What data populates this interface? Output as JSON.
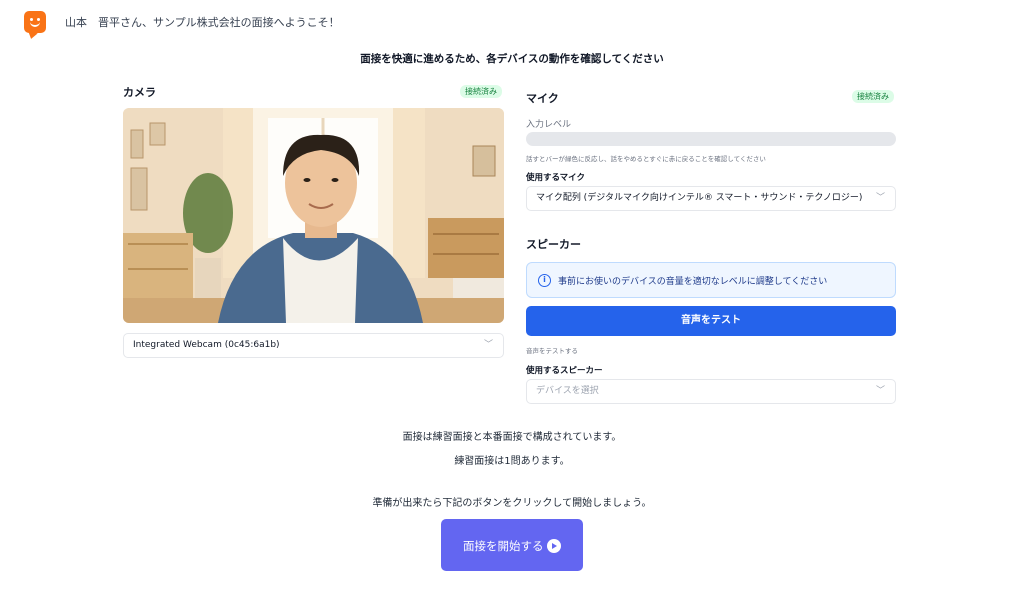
{
  "header": {
    "logo_icon": "smile-chat-icon",
    "welcome": "山本　晋平さん、サンプル株式会社の面接へようこそ！"
  },
  "subtitle": "面接を快適に進めるため、各デバイスの動作を確認してください",
  "camera": {
    "title": "カメラ",
    "status": "接続済み",
    "selected_device": "Integrated Webcam (0c45:6a1b)"
  },
  "mic": {
    "title": "マイク",
    "status": "接続済み",
    "level_label": "入力レベル",
    "level": 0,
    "hint": "話すとバーが緑色に反応し、話をやめるとすぐに赤に戻ることを確認してください",
    "select_label": "使用するマイク",
    "selected_device": "マイク配列 (デジタルマイク向けインテル® スマート・サウンド・テクノロジー)"
  },
  "speaker": {
    "title": "スピーカー",
    "info": "事前にお使いのデバイスの音量を適切なレベルに調整してください",
    "test_button": "音声をテスト",
    "test_hint": "音声をテストする",
    "select_label": "使用するスピーカー",
    "select_placeholder": "デバイスを選択"
  },
  "notes": {
    "line1": "面接は練習面接と本番面接で構成されています。",
    "line2": "練習面接は1問あります。",
    "line3": "準備が出来たら下記のボタンをクリックして開始しましょう。"
  },
  "start_button": "面接を開始する",
  "colors": {
    "accent": "#6366f1",
    "primary": "#2563eb",
    "success": "#15803d",
    "logo": "#f97316"
  }
}
